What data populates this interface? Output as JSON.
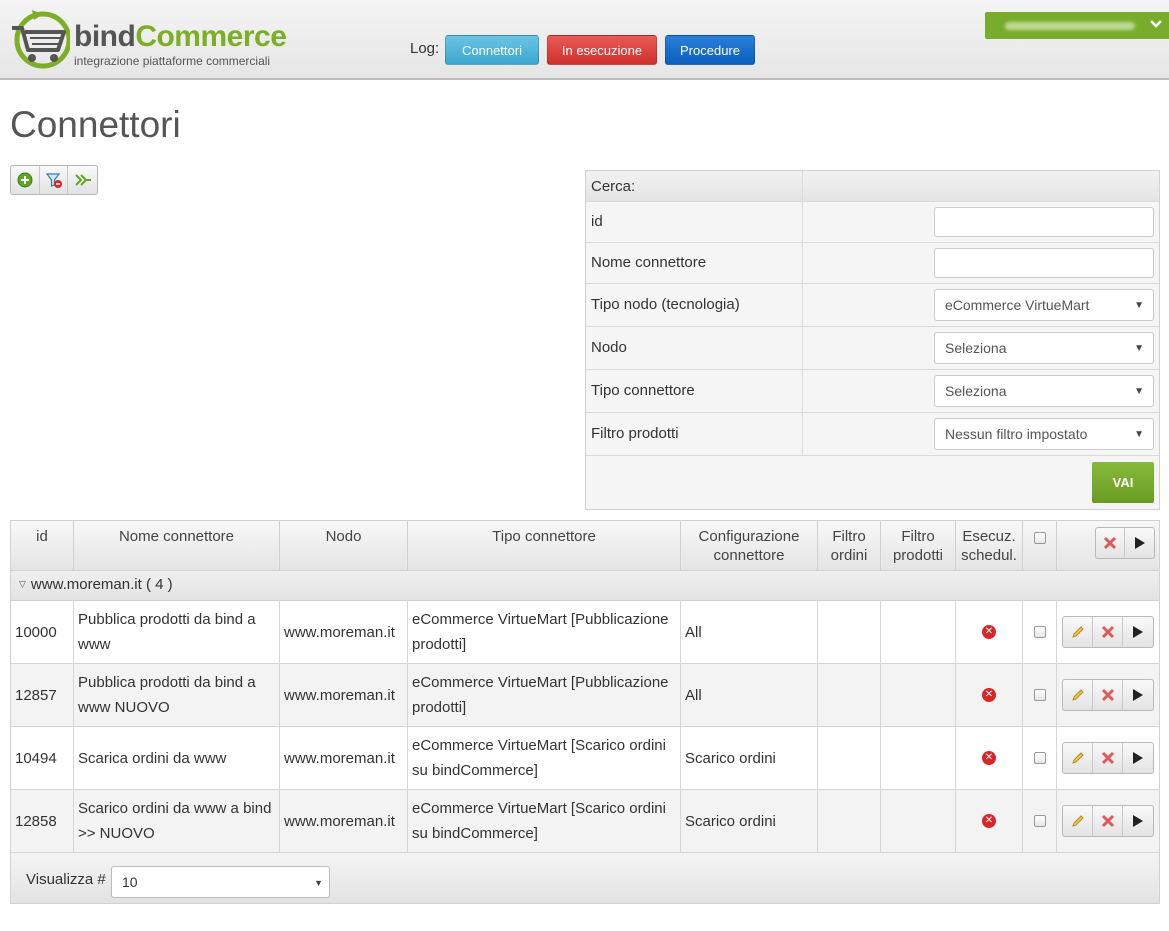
{
  "header": {
    "logo_brand_1": "bind",
    "logo_brand_2": "Commerce",
    "logo_tagline": "integrazione piattaforme commerciali",
    "log_label": "Log:",
    "log_buttons": [
      {
        "label": "Connettori",
        "color": "#46b1d8"
      },
      {
        "label": "In esecuzione",
        "color": "#d9403c"
      },
      {
        "label": "Procedure",
        "color": "#0f66c9"
      }
    ],
    "user_menu_color": "#7aac2c"
  },
  "page": {
    "title": "Connettori"
  },
  "toolbar": {
    "icons": [
      "add-icon",
      "clear-filter-icon",
      "forward-icon"
    ]
  },
  "search": {
    "header": "Cerca:",
    "fields": [
      {
        "label": "id",
        "type": "text",
        "value": ""
      },
      {
        "label": "Nome connettore",
        "type": "text",
        "value": ""
      },
      {
        "label": "Tipo nodo (tecnologia)",
        "type": "select",
        "value": "eCommerce VirtueMart"
      },
      {
        "label": "Nodo",
        "type": "select",
        "value": "Seleziona"
      },
      {
        "label": "Tipo connettore",
        "type": "select",
        "value": "Seleziona"
      },
      {
        "label": "Filtro prodotti",
        "type": "select",
        "value": "Nessun filtro impostato"
      }
    ],
    "submit_label": "VAI"
  },
  "table": {
    "columns": [
      "id",
      "Nome connettore",
      "Nodo",
      "Tipo connettore",
      "Configurazione connettore",
      "Filtro ordini",
      "Filtro prodotti",
      "Esecuz. schedul."
    ],
    "group_label": "www.moreman.it ( 4 )",
    "rows": [
      {
        "id": "10000",
        "name": "Pubblica prodotti da bind a www",
        "node": "www.moreman.it",
        "type": "eCommerce VirtueMart [Pubblicazione prodotti]",
        "config": "All",
        "filter_orders": "",
        "filter_products": ""
      },
      {
        "id": "12857",
        "name": "Pubblica prodotti da bind a www NUOVO",
        "node": "www.moreman.it",
        "type": "eCommerce VirtueMart [Pubblicazione prodotti]",
        "config": "All",
        "filter_orders": "",
        "filter_products": ""
      },
      {
        "id": "10494",
        "name": "Scarica ordini da www",
        "node": "www.moreman.it",
        "type": "eCommerce VirtueMart [Scarico ordini su bindCommerce]",
        "config": "Scarico ordini",
        "filter_orders": "",
        "filter_products": ""
      },
      {
        "id": "12858",
        "name": "Scarico ordini da www a bind >> NUOVO",
        "node": "www.moreman.it",
        "type": "eCommerce VirtueMart [Scarico ordini su bindCommerce]",
        "config": "Scarico ordini",
        "filter_orders": "",
        "filter_products": ""
      }
    ],
    "footer_label": "Visualizza #",
    "page_size": "10"
  }
}
